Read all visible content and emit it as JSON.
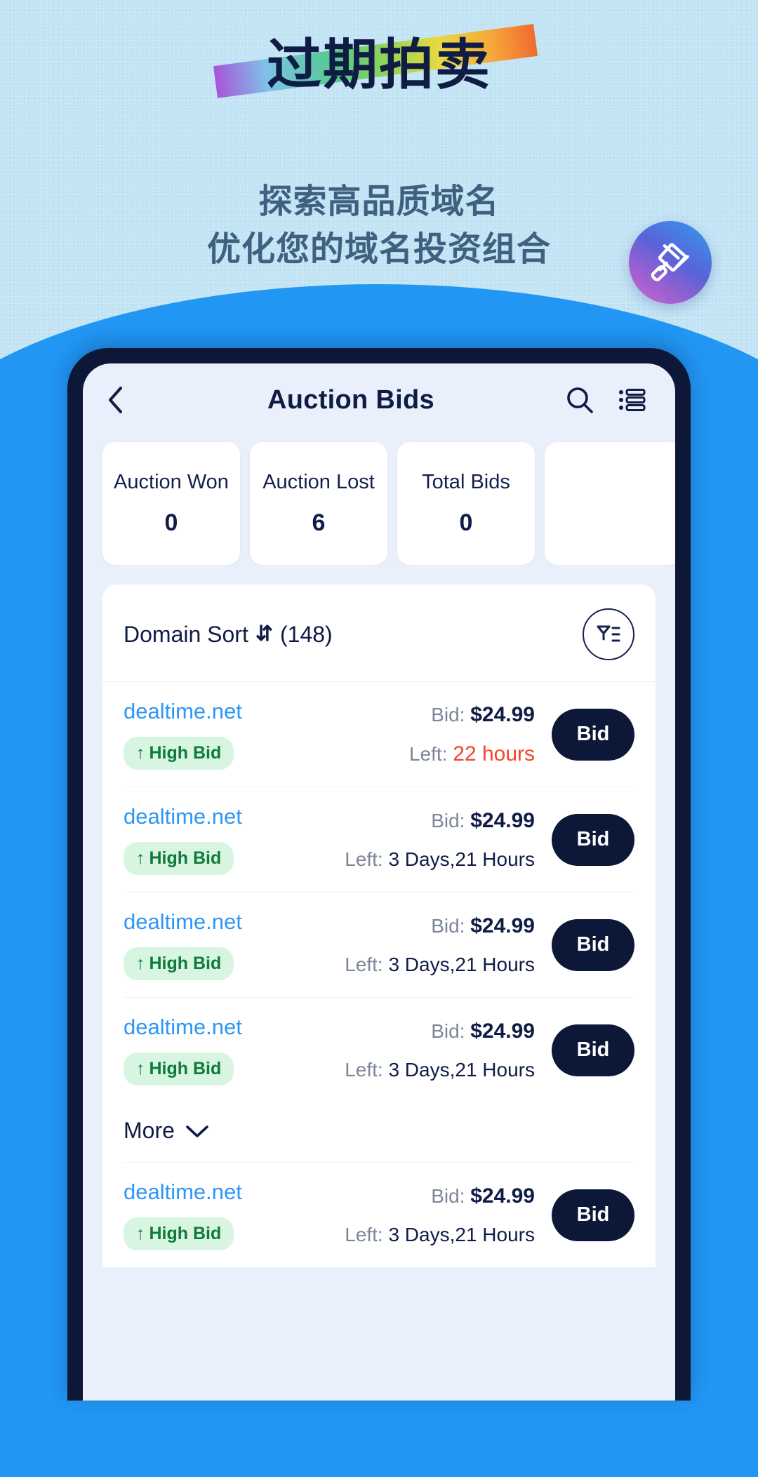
{
  "hero": {
    "title": "过期拍卖",
    "subtitle_line1": "探索高品质域名",
    "subtitle_line2": "优化您的域名投资组合",
    "badge_icon": "gavel-icon",
    "title_color": "#0f1c44",
    "subtitle_color": "#40607f",
    "stripe_gradient": "#a855d8 → #55c98d → #e9d940 → #f26a2e"
  },
  "app": {
    "header": {
      "back_icon": "chevron-left-icon",
      "title": "Auction Bids",
      "search_icon": "search-icon",
      "list_icon": "list-settings-icon"
    },
    "stats": [
      {
        "label": "Auction Won",
        "value": "0"
      },
      {
        "label": "Auction Lost",
        "value": "6"
      },
      {
        "label": "Total Bids",
        "value": "0"
      },
      {
        "label": "",
        "value": ""
      }
    ],
    "sort_bar": {
      "label": "Domain Sort",
      "sort_icon": "sort-updown-icon",
      "count": "(148)",
      "filter_icon": "filter-icon"
    },
    "rows": [
      {
        "domain": "dealtime.net",
        "status": "High Bid",
        "status_arrow": "↑",
        "bid_label": "Bid:",
        "bid_value": "$24.99",
        "left_label": "Left:",
        "left_value": "22 hours",
        "urgent": true,
        "action": "Bid"
      },
      {
        "domain": "dealtime.net",
        "status": "High Bid",
        "status_arrow": "↑",
        "bid_label": "Bid:",
        "bid_value": "$24.99",
        "left_label": "Left:",
        "left_value": "3 Days,21 Hours",
        "urgent": false,
        "action": "Bid"
      },
      {
        "domain": "dealtime.net",
        "status": "High Bid",
        "status_arrow": "↑",
        "bid_label": "Bid:",
        "bid_value": "$24.99",
        "left_label": "Left:",
        "left_value": "3 Days,21 Hours",
        "urgent": false,
        "action": "Bid"
      },
      {
        "domain": "dealtime.net",
        "status": "High Bid",
        "status_arrow": "↑",
        "bid_label": "Bid:",
        "bid_value": "$24.99",
        "left_label": "Left:",
        "left_value": "3 Days,21 Hours",
        "urgent": false,
        "action": "Bid"
      }
    ],
    "more": {
      "label": "More",
      "icon": "chevron-down-icon"
    },
    "rows_after_more": [
      {
        "domain": "dealtime.net",
        "status": "High Bid",
        "status_arrow": "↑",
        "bid_label": "Bid:",
        "bid_value": "$24.99",
        "left_label": "Left:",
        "left_value": "3 Days,21 Hours",
        "urgent": false,
        "action": "Bid"
      }
    ],
    "colors": {
      "accent_blue": "#2e96f5",
      "navy": "#101c46",
      "green_pill_bg": "#d7f5e0",
      "green_pill_text": "#0e7a3c",
      "urgent_red": "#f2452c",
      "blob_blue": "#2196f3",
      "screen_bg": "#eaf0fb"
    }
  }
}
